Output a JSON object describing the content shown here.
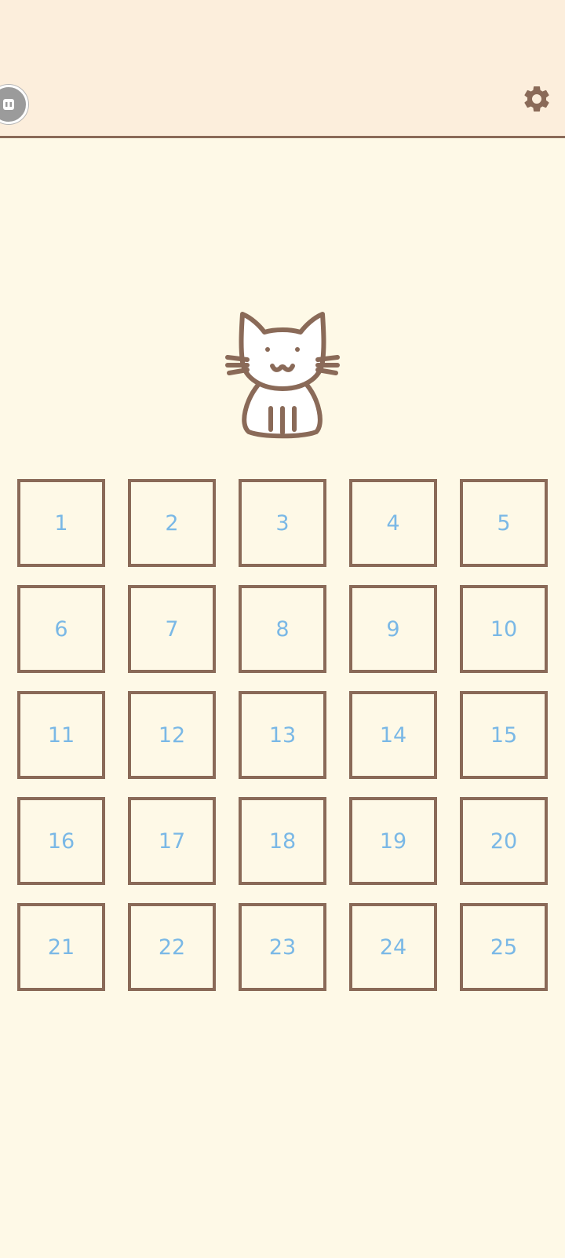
{
  "colors": {
    "background": "#FEF9E7",
    "header": "#FCEEDC",
    "border": "#8A6A58",
    "number": "#7AB8E6"
  },
  "icons": {
    "settings": "gear-icon",
    "assistant": "floating-assistant-icon",
    "mascot": "cat-mascot-icon"
  },
  "levels": [
    "1",
    "2",
    "3",
    "4",
    "5",
    "6",
    "7",
    "8",
    "9",
    "10",
    "11",
    "12",
    "13",
    "14",
    "15",
    "16",
    "17",
    "18",
    "19",
    "20",
    "21",
    "22",
    "23",
    "24",
    "25"
  ]
}
